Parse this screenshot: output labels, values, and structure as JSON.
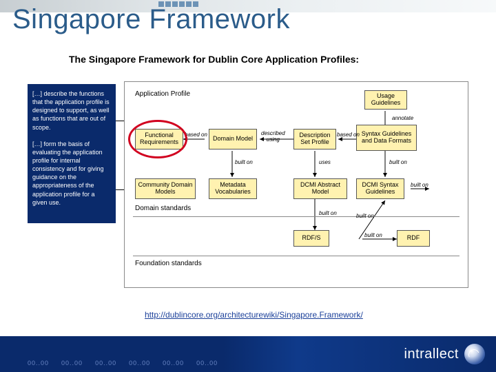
{
  "title": "Singapore Framework",
  "subtitle": "The Singapore Framework for Dublin Core Application Profiles:",
  "sidebar": {
    "p1": "[…] describe the functions that the application profile is designed to support, as well as functions that are out of scope.",
    "p2": "[…] form the basis of evaluating the application profile for internal consistency and for giving guidance on the appropriateness of the application profile for a given use."
  },
  "diagram": {
    "row_top": {
      "application_profile": "Application Profile",
      "usage_guidelines": "Usage\nGuidelines"
    },
    "row_mid": {
      "functional_requirements": "Functional\nRequirements",
      "domain_model": "Domain\nModel",
      "description_set_profile": "Description\nSet Profile",
      "syntax_guidelines": "Syntax\nGuidelines and\nData Formats"
    },
    "row_dom": {
      "community_domain_models": "Community\nDomain Models",
      "metadata_vocabularies": "Metadata\nVocabularies",
      "dcmi_abstract_model": "DCMI Abstract\nModel",
      "dcmi_syntax_guidelines": "DCMI Syntax\nGuidelines"
    },
    "row_found": {
      "rdfs": "RDF/S",
      "rdf": "RDF"
    },
    "rels": {
      "annotate": "annotate",
      "based_on_1": "based on",
      "described_using": "described\nusing",
      "based_on_2": "based on",
      "built_on_1": "built on",
      "uses": "uses",
      "built_on_2": "built on",
      "built_on_3": "built on",
      "built_on_4": "built on",
      "built_on_5": "built on"
    },
    "section_domain_standards": "Domain standards",
    "section_foundation_standards": "Foundation standards"
  },
  "url": "http://dublincore.org/architecturewiki/Singapore.Framework/",
  "footer_brand": "intrallect"
}
